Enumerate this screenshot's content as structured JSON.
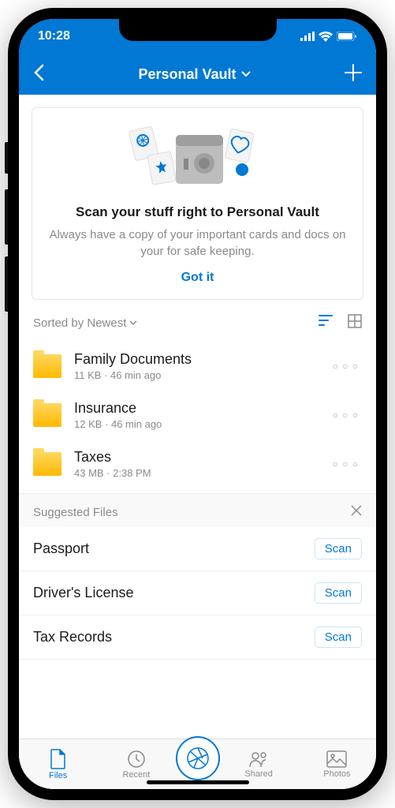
{
  "status": {
    "time": "10:28"
  },
  "nav": {
    "title": "Personal Vault"
  },
  "promo": {
    "title": "Scan your stuff right to Personal Vault",
    "body": "Always have a copy of your important cards and docs on your for safe keeping.",
    "button": "Got it"
  },
  "sort": {
    "label": "Sorted by Newest"
  },
  "files": [
    {
      "name": "Family Documents",
      "meta": "11 KB · 46 min ago"
    },
    {
      "name": "Insurance",
      "meta": "12 KB · 46 min ago"
    },
    {
      "name": "Taxes",
      "meta": "43 MB · 2:38 PM"
    }
  ],
  "suggested": {
    "header": "Suggested Files",
    "scan_label": "Scan",
    "items": [
      "Passport",
      "Driver's License",
      "Tax Records"
    ]
  },
  "tabs": {
    "files": "Files",
    "recent": "Recent",
    "shared": "Shared",
    "photos": "Photos"
  }
}
